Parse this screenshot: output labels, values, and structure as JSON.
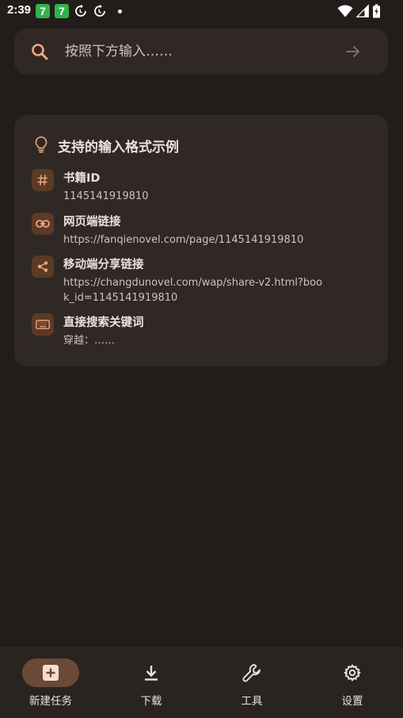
{
  "status_bar": {
    "time": "2:39",
    "badge_1": "7",
    "badge_2": "7",
    "icons": [
      "app-badge-icon",
      "app-badge-icon",
      "sync-icon",
      "sync-icon",
      "dot-icon"
    ],
    "right_icons": [
      "wifi-icon",
      "signal-icon",
      "battery-icon"
    ]
  },
  "search": {
    "placeholder": "按照下方输入……",
    "value": ""
  },
  "format_card": {
    "title": "支持的输入格式示例",
    "items": [
      {
        "icon": "hash-icon",
        "label": "书籍ID",
        "example": "1145141919810"
      },
      {
        "icon": "link-icon",
        "label": "网页端链接",
        "example": "https://fanqienovel.com/page/1145141919810"
      },
      {
        "icon": "share-icon",
        "label": "移动端分享链接",
        "example": "https://changdunovel.com/wap/share-v2.html?book_id=1145141919810"
      },
      {
        "icon": "keyboard-icon",
        "label": "直接搜索关键词",
        "example": "穿越：……"
      }
    ]
  },
  "bottom_nav": {
    "items": [
      {
        "label": "新建任务",
        "icon": "add-box-icon",
        "active": true
      },
      {
        "label": "下载",
        "icon": "download-icon",
        "active": false
      },
      {
        "label": "工具",
        "icon": "wrench-icon",
        "active": false
      },
      {
        "label": "设置",
        "icon": "gear-icon",
        "active": false
      }
    ]
  },
  "colors": {
    "background": "#221d1b",
    "surface": "#2f2825",
    "accent": "#f0a57c",
    "icon_box": "#5b3a27",
    "nav_active": "#6a4a36",
    "text": "#ece0da",
    "text_secondary": "#cfc2bb"
  }
}
